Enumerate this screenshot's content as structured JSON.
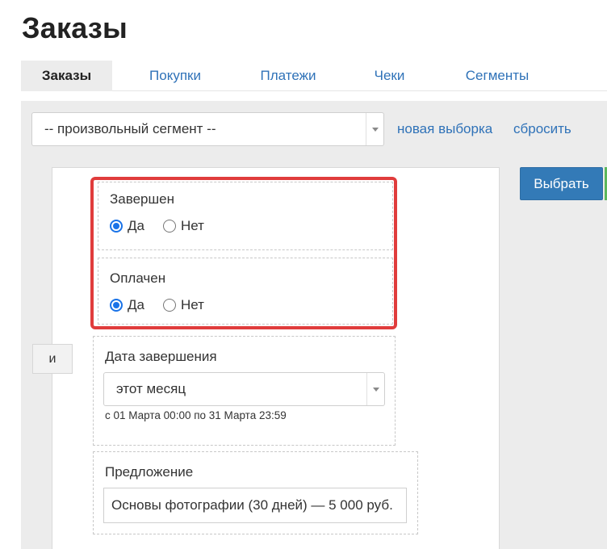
{
  "page": {
    "title": "Заказы"
  },
  "tabs": [
    {
      "label": "Заказы",
      "active": true
    },
    {
      "label": "Покупки",
      "active": false
    },
    {
      "label": "Платежи",
      "active": false
    },
    {
      "label": "Чеки",
      "active": false
    },
    {
      "label": "Сегменты",
      "active": false
    }
  ],
  "toolbar": {
    "segment_value": "-- произвольный сегмент --",
    "new_selection_label": "новая выборка",
    "reset_label": "сбросить"
  },
  "actions": {
    "select_label": "Выбрать"
  },
  "logic": {
    "and_label": "и"
  },
  "conditions": {
    "completed": {
      "title": "Завершен",
      "yes": "Да",
      "no": "Нет",
      "selected": "yes"
    },
    "paid": {
      "title": "Оплачен",
      "yes": "Да",
      "no": "Нет",
      "selected": "yes"
    },
    "completion_date": {
      "title": "Дата завершения",
      "value": "этот месяц",
      "range_text": "с 01 Марта 00:00 по 31 Марта 23:59"
    },
    "offer": {
      "title": "Предложение",
      "value": "Основы фотографии (30 дней) — 5 000 руб."
    }
  },
  "colors": {
    "link": "#2f72b8",
    "primary_button": "#337ab7",
    "highlight": "#e03c3c",
    "radio_checked": "#1a73e8"
  }
}
